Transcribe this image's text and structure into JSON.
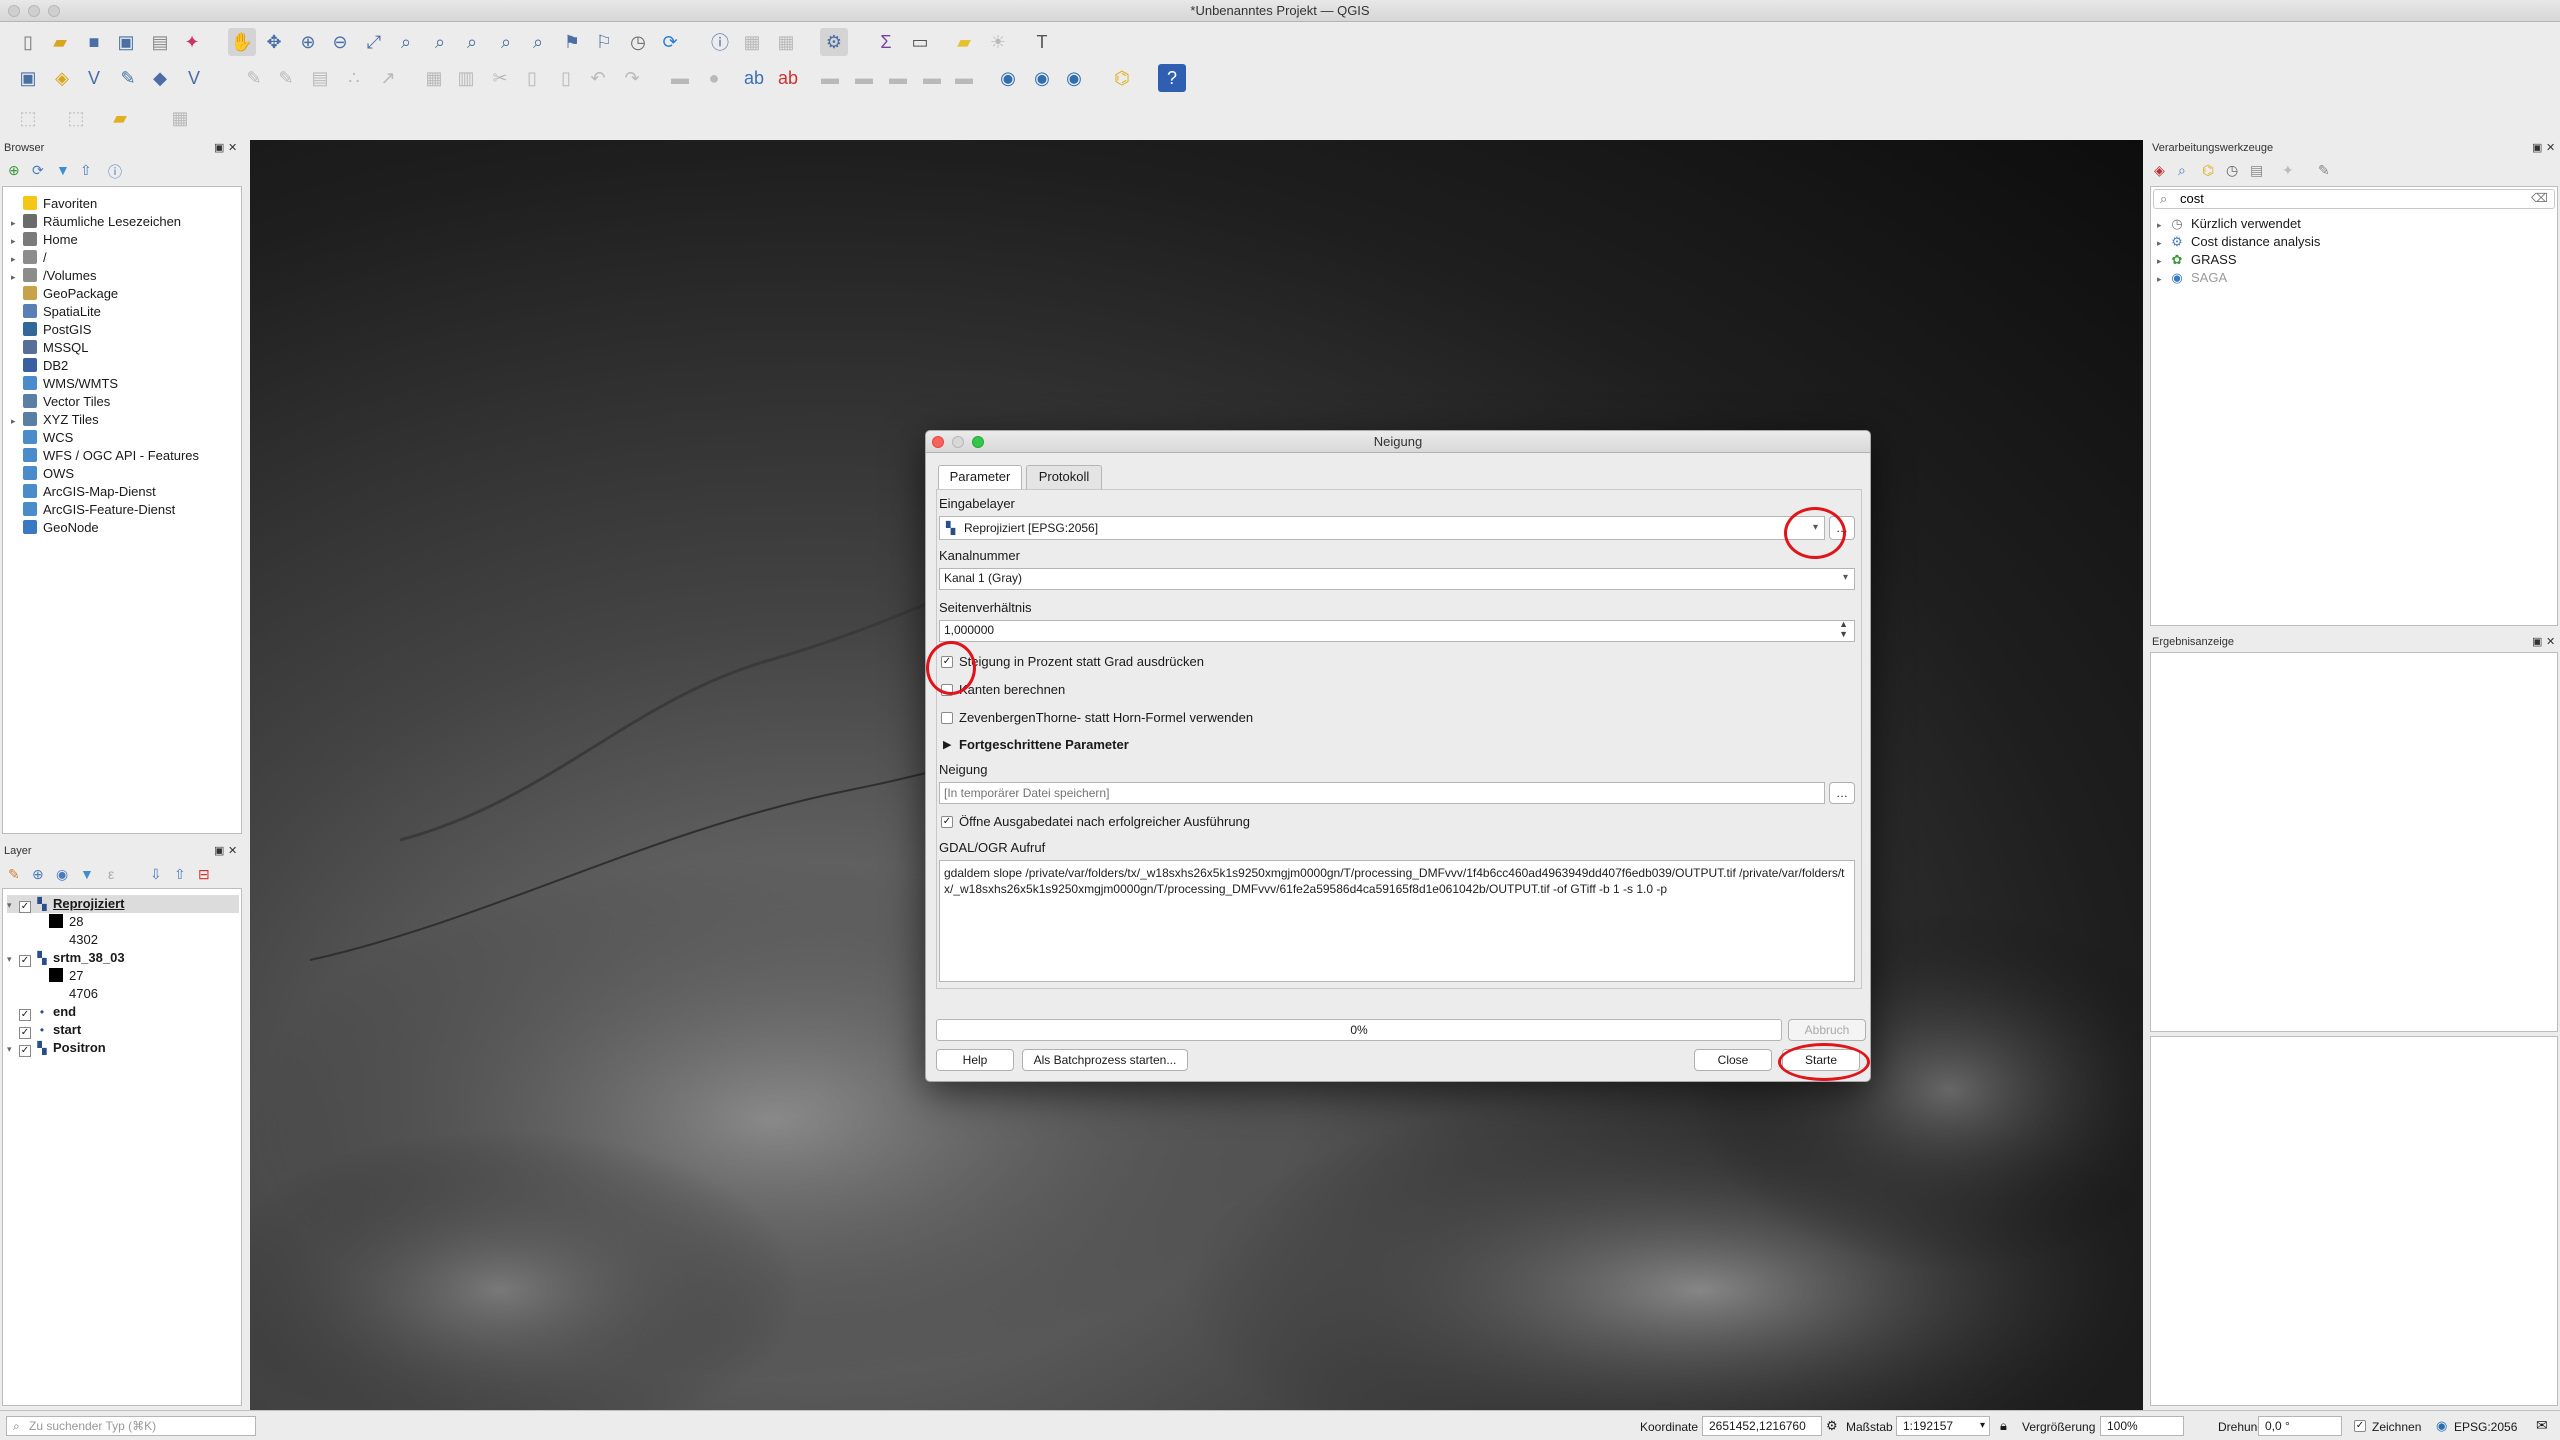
{
  "window": {
    "title": "*Unbenanntes Projekt — QGIS"
  },
  "browser": {
    "title": "Browser",
    "items": [
      {
        "label": "Favoriten",
        "icon": "star-icon",
        "color": "#f5c518",
        "expand": false
      },
      {
        "label": "Räumliche Lesezeichen",
        "icon": "bookmark-icon",
        "color": "#6b6b6b",
        "expand": true
      },
      {
        "label": "Home",
        "icon": "home-folder-icon",
        "color": "#7a7a7a",
        "expand": true
      },
      {
        "label": "/",
        "icon": "folder-icon",
        "color": "#8c8c8c",
        "expand": true
      },
      {
        "label": "/Volumes",
        "icon": "folder-icon",
        "color": "#8c8c8c",
        "expand": true
      },
      {
        "label": "GeoPackage",
        "icon": "geopackage-icon",
        "color": "#c8a24a",
        "expand": false
      },
      {
        "label": "SpatiaLite",
        "icon": "spatialite-icon",
        "color": "#5a7fb5",
        "expand": false
      },
      {
        "label": "PostGIS",
        "icon": "postgis-icon",
        "color": "#336699",
        "expand": false
      },
      {
        "label": "MSSQL",
        "icon": "mssql-icon",
        "color": "#556f99",
        "expand": false
      },
      {
        "label": "DB2",
        "icon": "db2-icon",
        "color": "#3a5fa0",
        "expand": false
      },
      {
        "label": "WMS/WMTS",
        "icon": "globe-icon",
        "color": "#4a8bc9",
        "expand": false
      },
      {
        "label": "Vector Tiles",
        "icon": "grid-icon",
        "color": "#5a7fa5",
        "expand": false
      },
      {
        "label": "XYZ Tiles",
        "icon": "grid-icon",
        "color": "#5a7fa5",
        "expand": true
      },
      {
        "label": "WCS",
        "icon": "globe-icon",
        "color": "#4a8bc9",
        "expand": false
      },
      {
        "label": "WFS / OGC API - Features",
        "icon": "globe-icon",
        "color": "#4a8bc9",
        "expand": false
      },
      {
        "label": "OWS",
        "icon": "globe-icon",
        "color": "#4a8bc9",
        "expand": false
      },
      {
        "label": "ArcGIS-Map-Dienst",
        "icon": "globe-icon",
        "color": "#4a8bc9",
        "expand": false
      },
      {
        "label": "ArcGIS-Feature-Dienst",
        "icon": "globe-icon",
        "color": "#4a8bc9",
        "expand": false
      },
      {
        "label": "GeoNode",
        "icon": "geonode-icon",
        "color": "#3b78c3",
        "expand": false
      }
    ]
  },
  "layers": {
    "title": "Layer",
    "rows": [
      {
        "type": "layer",
        "label": "Reprojiziert",
        "checked": true,
        "expand": true,
        "selected": true
      },
      {
        "type": "legend",
        "label": "28",
        "swatch": "#000000"
      },
      {
        "type": "legend",
        "label": "4302",
        "swatch": ""
      },
      {
        "type": "layer",
        "label": "srtm_38_03",
        "checked": true,
        "expand": true,
        "selected": false
      },
      {
        "type": "legend",
        "label": "27",
        "swatch": "#000000"
      },
      {
        "type": "legend",
        "label": "4706",
        "swatch": ""
      },
      {
        "type": "layer",
        "label": "end",
        "checked": true,
        "expand": false,
        "selected": false,
        "point": true
      },
      {
        "type": "layer",
        "label": "start",
        "checked": true,
        "expand": false,
        "selected": false,
        "point": true
      },
      {
        "type": "layer",
        "label": "Positron",
        "checked": true,
        "expand": true,
        "selected": false
      }
    ]
  },
  "processing": {
    "title": "Verarbeitungswerkzeuge",
    "search_value": "cost",
    "items": [
      {
        "label": "Kürzlich verwendet",
        "icon": "clock-icon",
        "dim": false
      },
      {
        "label": "Cost distance analysis",
        "icon": "gear-icon",
        "dim": false
      },
      {
        "label": "GRASS",
        "icon": "grass-icon",
        "dim": false
      },
      {
        "label": "SAGA",
        "icon": "saga-icon",
        "dim": true
      }
    ]
  },
  "results": {
    "title": "Ergebnisanzeige"
  },
  "dialog": {
    "title": "Neigung",
    "tabs": [
      "Parameter",
      "Protokoll"
    ],
    "input_layer_label": "Eingabelayer",
    "input_layer_value": "Reprojiziert [EPSG:2056]",
    "band_label": "Kanalnummer",
    "band_value": "Kanal 1 (Gray)",
    "ratio_label": "Seitenverhältnis",
    "ratio_value": "1,000000",
    "opt_percent": "Steigung in Prozent statt Grad ausdrücken",
    "opt_percent_checked": true,
    "opt_edges": "Kanten berechnen",
    "opt_edges_checked": false,
    "opt_zevenbergen": "ZevenbergenThorne- statt Horn-Formel verwenden",
    "opt_zevenbergen_checked": false,
    "advanced_label": "Fortgeschrittene Parameter",
    "output_label": "Neigung",
    "output_placeholder": "[In temporärer Datei speichern]",
    "open_output": "Öffne Ausgabedatei nach erfolgreicher Ausführung",
    "open_output_checked": true,
    "gdal_label": "GDAL/OGR Aufruf",
    "gdal_command": "gdaldem slope /private/var/folders/tx/_w18sxhs26x5k1s9250xmgjm0000gn/T/processing_DMFvvv/1f4b6cc460ad4963949dd407f6edb039/OUTPUT.tif /private/var/folders/tx/_w18sxhs26x5k1s9250xmgjm0000gn/T/processing_DMFvvv/61fe2a59586d4ca59165f8d1e061042b/OUTPUT.tif -of GTiff -b 1 -s 1.0 -p",
    "progress_text": "0%",
    "progress": 0,
    "btn_cancel": "Abbruch",
    "btn_help": "Help",
    "btn_batch": "Als Batchprozess starten...",
    "btn_close": "Close",
    "btn_start": "Starte"
  },
  "statusbar": {
    "search_placeholder": "Zu suchender Typ (⌘K)",
    "coord_label": "Koordinate",
    "coord_value": "2651452,1216760",
    "scale_label": "Maßstab",
    "scale_value": "1:192157",
    "magnifier_label": "Vergrößerung",
    "magnifier_value": "100%",
    "rotation_label": "Drehung",
    "rotation_value": "0,0 °",
    "render_label": "Zeichnen",
    "crs": "EPSG:2056"
  },
  "colors": {
    "accent": "#4a6fa5",
    "highlight": "#e0141a"
  }
}
